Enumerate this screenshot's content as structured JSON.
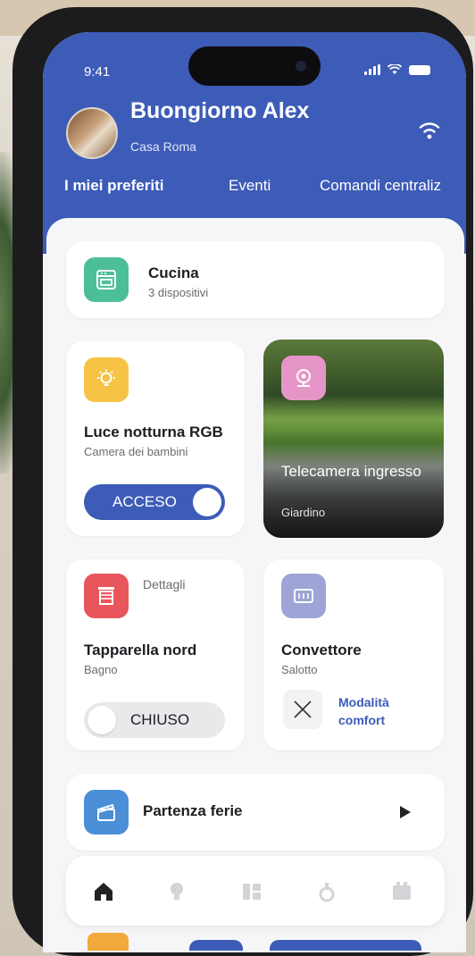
{
  "status": {
    "time": "9:41"
  },
  "header": {
    "greeting": "Buongiorno Alex",
    "home": "Casa Roma"
  },
  "tabs": [
    {
      "label": "I miei preferiti",
      "active": true
    },
    {
      "label": "Eventi",
      "active": false
    },
    {
      "label": "Comandi centraliz",
      "active": false
    }
  ],
  "cards": {
    "kitchen": {
      "title": "Cucina",
      "subtitle": "3 dispositivi",
      "icon": "oven-icon",
      "color": "#4cbf9a"
    },
    "light": {
      "title": "Luce notturna RGB",
      "subtitle": "Camera dei bambini",
      "toggle_label": "ACCESO",
      "on": true,
      "icon": "lightbulb-icon",
      "color": "#f6c346"
    },
    "camera": {
      "title": "Telecamera ingresso",
      "subtitle": "Giardino",
      "icon": "camera-icon",
      "color": "#e695c8"
    },
    "shutter": {
      "title": "Tapparella nord",
      "subtitle": "Bagno",
      "details": "Dettagli",
      "toggle_label": "CHIUSO",
      "on": false,
      "icon": "shutter-icon",
      "color": "#e8555a"
    },
    "convector": {
      "title": "Convettore",
      "subtitle": "Salotto",
      "mode_label": "Modalità comfort",
      "icon": "heater-icon",
      "color": "#9ea4d6"
    },
    "scene": {
      "title": "Partenza ferie",
      "icon": "clapperboard-icon",
      "color": "#4a8fd7"
    }
  },
  "bottom_nav": [
    "home-icon",
    "lightbulb-icon",
    "devices-icon",
    "security-icon",
    "energy-icon"
  ],
  "colors": {
    "primary": "#3d5cb8",
    "background": "#f6f6f8"
  }
}
